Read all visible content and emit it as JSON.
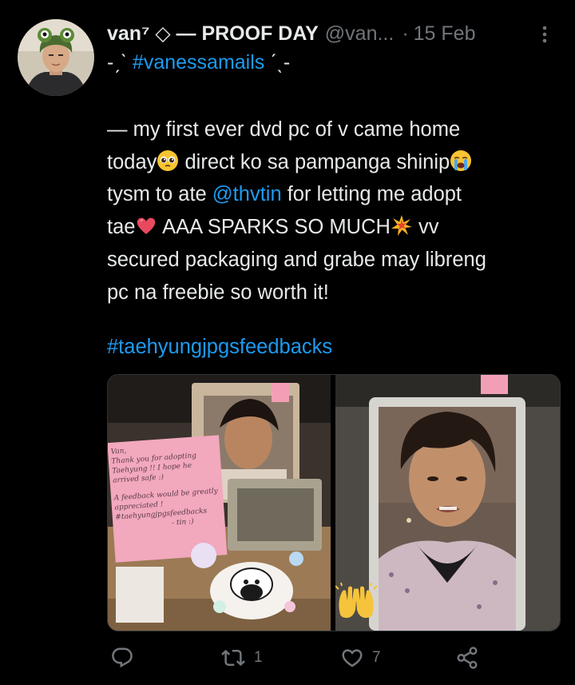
{
  "tweet": {
    "display_name": "van⁷ ◇ — PROOF DAY",
    "handle": "@van...",
    "separator": "·",
    "date": "15 Feb",
    "subline_prefix": "-ˏˋ ",
    "subline_hashtag": "#vanessamails",
    "subline_suffix": " ˊˎ-",
    "body": {
      "l1": "— my first ever dvd pc of v came home",
      "l2a": "today",
      "l2b": " direct ko sa pampanga shinip",
      "l3a": "tysm to ate ",
      "l3_mention": "@thvtin",
      "l3b": " for letting me adopt",
      "l4a": "tae",
      "l4b": " AAA SPARKS SO MUCH",
      "l4c": " vv",
      "l5": "secured packaging and grabe may libreng",
      "l6": "pc na freebie so worth it!"
    },
    "hashtag_line": "#taehyungjpgsfeedbacks",
    "note_text": {
      "n1": "Van,",
      "n2": "Thank you for adopting",
      "n3": "Taehyung !! I hope he",
      "n4": "arrived safe :)",
      "n5": "A feedback would be greatly",
      "n6": "appreciated !",
      "n7": "#taehyungjpgsfeedbacks",
      "n8": "- tin :)"
    }
  },
  "actions": {
    "reply_count": "",
    "retweet_count": "1",
    "like_count": "7"
  },
  "colors": {
    "background": "#000000",
    "text": "#e7e9ea",
    "muted": "#71767b",
    "link": "#1d9bf0"
  },
  "icons": [
    "more-icon",
    "reply-icon",
    "retweet-icon",
    "like-icon",
    "share-icon",
    "pleading-face-emoji",
    "crying-face-emoji",
    "heart-emoji",
    "sparkle-burst-emoji",
    "clapping-hands-emoji"
  ]
}
